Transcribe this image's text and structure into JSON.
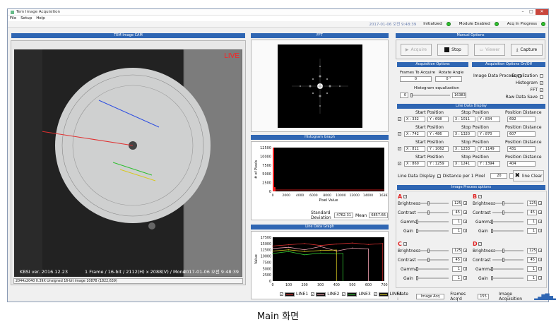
{
  "window": {
    "title": "Tem Image Acquisition",
    "menu": [
      "File",
      "Setup",
      "Help"
    ]
  },
  "status": {
    "datetime": "2017-01-06 오전 9:48:39",
    "initialized": "Initialized",
    "module": "Module Enabled",
    "acq": "Acq In Progress"
  },
  "cam": {
    "header": "TEM Image CAM",
    "live": "LIVE",
    "version": "KBSI ver. 2016.12.23",
    "frame_info": "1 Frame / 16-bit / 2112(H) x 2088(V) / Mono",
    "timestamp": "2017-01-06 오전 9:48:39",
    "statusline": "2044x2040  0.39X  Unsigned 16-bit image 10878    (1822,639)"
  },
  "fft": {
    "header": "FFT"
  },
  "histogram": {
    "header": "Histogram Graph",
    "ylabel": "# of Pixels",
    "xlabel": "Pixel Value",
    "std_label": "Standard Deviation",
    "std_value": "4762.31",
    "mean_label": "Mean",
    "mean_value": "6857.66"
  },
  "linegraph": {
    "header": "Line Data Graph",
    "ylabel": "Value",
    "legend": [
      "LINE1",
      "LINE2",
      "LINE3",
      "LINE4"
    ]
  },
  "manual": {
    "header": "Manual Options",
    "acquire": "Acquire",
    "stop": "Stop",
    "viewer": "Viewer",
    "capture": "Capture"
  },
  "acqopt": {
    "header": "Acquisition Options",
    "frames_label": "Frames To Acquire",
    "frames_value": "0",
    "rotate_label": "Rotate Angle",
    "rotate_value": "0 °",
    "histeq_label": "Histogram equalization",
    "histeq_min": "0",
    "histeq_max": "16383"
  },
  "acqonoff": {
    "header": "Acquisition Options On/Off",
    "image_process": "Image Data Process",
    "equalization": "Equalization",
    "histogram": "Histogram",
    "fft": "FFT",
    "raw_save": "Raw Data Save"
  },
  "linedata": {
    "header": "Line Data Display",
    "start": "Start Position",
    "stop": "Stop Position",
    "dist": "Position Distance",
    "rows": [
      {
        "sx": "X : 332",
        "sy": "Y : 698",
        "ex": "X : 1011",
        "ey": "Y : 834",
        "d": "692"
      },
      {
        "sx": "X : 742",
        "sy": "Y : 486",
        "ex": "X : 1320",
        "ey": "Y : 870",
        "d": "607"
      },
      {
        "sx": "X : 811",
        "sy": "Y : 1062",
        "ex": "X : 1233",
        "ey": "Y : 1149",
        "d": "431"
      },
      {
        "sx": "X : 860",
        "sy": "Y : 1259",
        "ex": "X : 1241",
        "ey": "Y : 1394",
        "d": "404"
      }
    ],
    "display_label": "Line Data Display",
    "distance_label": "Distance per 1 Pixel",
    "distance_value": "20",
    "unit": "cm",
    "clear": "line Clear"
  },
  "process": {
    "header": "Image Process options",
    "groups": [
      {
        "id": "A",
        "brightness": "125",
        "contrast": "45",
        "gamma": "1",
        "gain": "1"
      },
      {
        "id": "B",
        "brightness": "125",
        "contrast": "45",
        "gamma": "1",
        "gain": "1"
      },
      {
        "id": "C",
        "brightness": "125",
        "contrast": "45",
        "gamma": "1",
        "gain": "1"
      },
      {
        "id": "D",
        "brightness": "125",
        "contrast": "45",
        "gamma": "1",
        "gain": "1"
      }
    ],
    "labels": {
      "brightness": "Brightness",
      "contrast": "Contrast",
      "gamma": "Gamma",
      "gain": "Gain"
    }
  },
  "bottom": {
    "state_label": "State :",
    "state_value": "Image Acq",
    "frames_label": "Frames Acq'd",
    "frames_value": "155",
    "acq_label": "Image Acquisition"
  },
  "caption": "Main 화면",
  "chart_data": [
    {
      "type": "bar",
      "title": "Histogram Graph",
      "xlabel": "Pixel Value",
      "ylabel": "# of Pixels",
      "ylim": [
        0,
        12500
      ],
      "xlim": [
        0,
        16383
      ],
      "yticks": [
        0,
        2500,
        5000,
        7500,
        10000,
        12500
      ],
      "xticks": [
        0,
        2000,
        4000,
        6000,
        8000,
        10000,
        12000,
        14000,
        16383
      ],
      "x": [
        0,
        200
      ],
      "values": [
        12500,
        1200
      ]
    },
    {
      "type": "line",
      "title": "Line Data Graph",
      "xlabel": "",
      "ylabel": "Value",
      "ylim": [
        0,
        17500
      ],
      "xlim": [
        0,
        700
      ],
      "yticks": [
        0,
        2500,
        5000,
        7500,
        10000,
        12500,
        15000,
        17500
      ],
      "xticks": [
        0,
        100,
        200,
        300,
        400,
        500,
        600,
        700
      ],
      "series": [
        {
          "name": "LINE1",
          "color": "#e03030",
          "x": [
            0,
            100,
            200,
            300,
            400,
            500,
            600,
            690
          ],
          "values": [
            14000,
            14500,
            15000,
            14200,
            14800,
            15200,
            14600,
            15000
          ]
        },
        {
          "name": "LINE2",
          "color": "#f0a0b0",
          "x": [
            0,
            100,
            200,
            300,
            400,
            500,
            600
          ],
          "values": [
            13000,
            13500,
            12500,
            13800,
            12000,
            13200,
            12800
          ]
        },
        {
          "name": "LINE3",
          "color": "#2fbf2f",
          "x": [
            0,
            100,
            200,
            300,
            400,
            440
          ],
          "values": [
            11000,
            11800,
            10500,
            11200,
            10800,
            11000
          ]
        },
        {
          "name": "LINE4",
          "color": "#d8c820",
          "x": [
            0,
            100,
            200,
            300,
            400
          ],
          "values": [
            12000,
            12500,
            11800,
            12200,
            12400
          ]
        }
      ]
    }
  ]
}
